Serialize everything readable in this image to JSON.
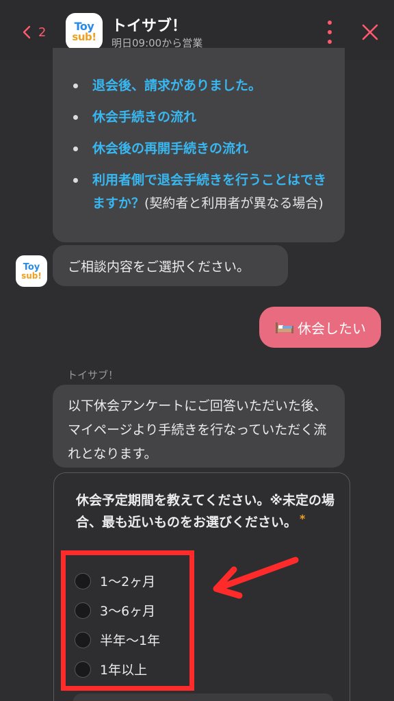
{
  "header": {
    "back_count": "2",
    "logo_line1": "Toy",
    "logo_line2": "sub!",
    "title": "トイサブ！",
    "subtitle": "明日09:00から営業"
  },
  "faq_links": [
    {
      "link": "退会後、請求がありました。",
      "rest": ""
    },
    {
      "link": "休会手続きの流れ",
      "rest": ""
    },
    {
      "link": "休会後の再開手続きの流れ",
      "rest": ""
    },
    {
      "link": "利用者側で退会手続きを行うことはできますか？",
      "rest": "(契約者と利用者が異なる場合)"
    }
  ],
  "bot_prompt": "ご相談内容をご選択ください。",
  "user_message": "休会したい",
  "sender_name": "トイサブ！",
  "info_message": "以下休会アンケートにご回答いただいた後、マイページより手続きを行なっていただく流れとなります。",
  "form": {
    "question": "休会予定期間を教えてください。※未定の場合、最も近いものをお選びください。",
    "required_mark": "*",
    "options": [
      "1〜2ヶ月",
      "3〜6ヶ月",
      "半年〜1年",
      "1年以上"
    ]
  },
  "colors": {
    "accent": "#ff5a6e",
    "link": "#38b7f0",
    "user_bubble": "#e96b7f",
    "highlight": "#ff2a2a"
  }
}
